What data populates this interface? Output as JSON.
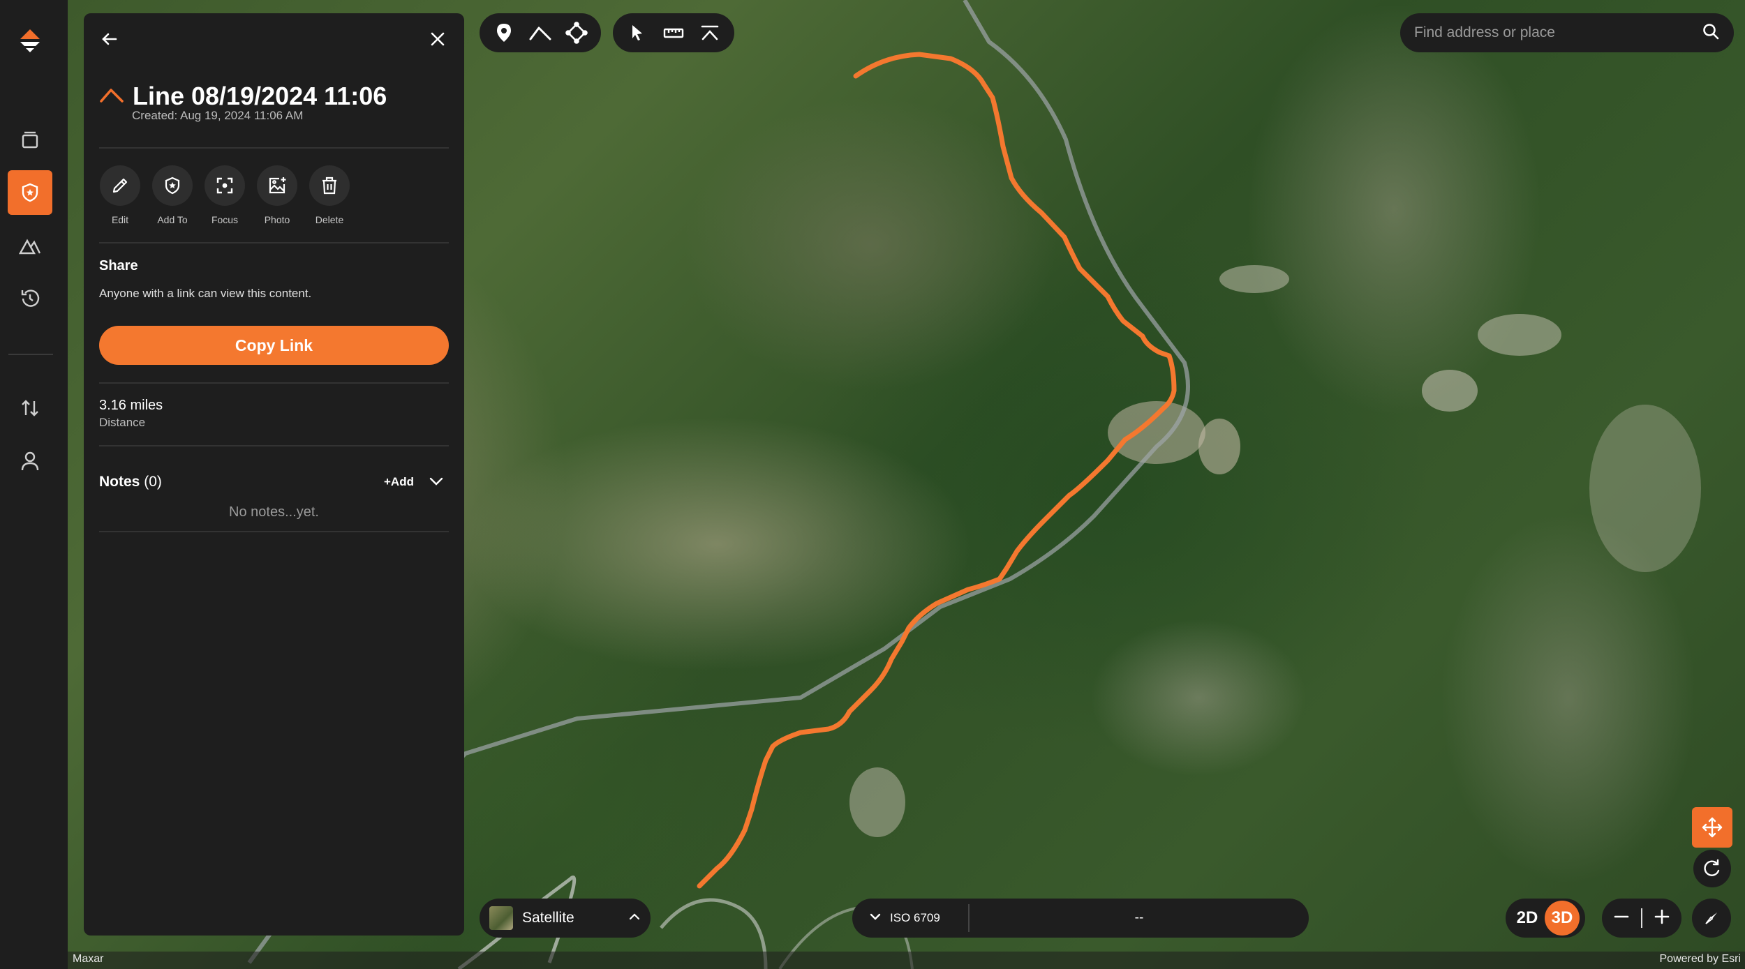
{
  "colors": {
    "accent": "#f26f2b",
    "panel": "#1e1e1e",
    "track": "#f4782f"
  },
  "leftnav": {
    "items": [
      {
        "name": "logo-icon"
      },
      {
        "name": "layers-icon"
      },
      {
        "name": "shield-icon",
        "active": true
      },
      {
        "name": "terrain-icon"
      },
      {
        "name": "history-icon"
      },
      {
        "name": "import-export-icon"
      },
      {
        "name": "user-icon"
      }
    ]
  },
  "panel": {
    "title": "Line 08/19/2024 11:06",
    "created": "Created: Aug 19, 2024 11:06 AM",
    "actions": [
      {
        "label": "Edit",
        "icon": "pencil-icon"
      },
      {
        "label": "Add To",
        "icon": "shield-star-icon"
      },
      {
        "label": "Focus",
        "icon": "focus-icon"
      },
      {
        "label": "Photo",
        "icon": "add-photo-icon"
      },
      {
        "label": "Delete",
        "icon": "trash-icon"
      }
    ],
    "share": {
      "title": "Share",
      "description": "Anyone with a link can view this content.",
      "button": "Copy Link"
    },
    "distance": {
      "value": "3.16 miles",
      "label": "Distance"
    },
    "notes": {
      "title": "Notes",
      "count": "(0)",
      "add": "+Add",
      "empty": "No notes...yet."
    }
  },
  "search": {
    "placeholder": "Find address or place"
  },
  "map": {
    "layer": "Satellite",
    "coordinate_system": "ISO 6709",
    "coordinate_value": "--",
    "view_2d": "2D",
    "view_3d": "3D",
    "active_view": "3D",
    "attribution_left": "Maxar",
    "attribution_right": "Powered by Esri"
  }
}
